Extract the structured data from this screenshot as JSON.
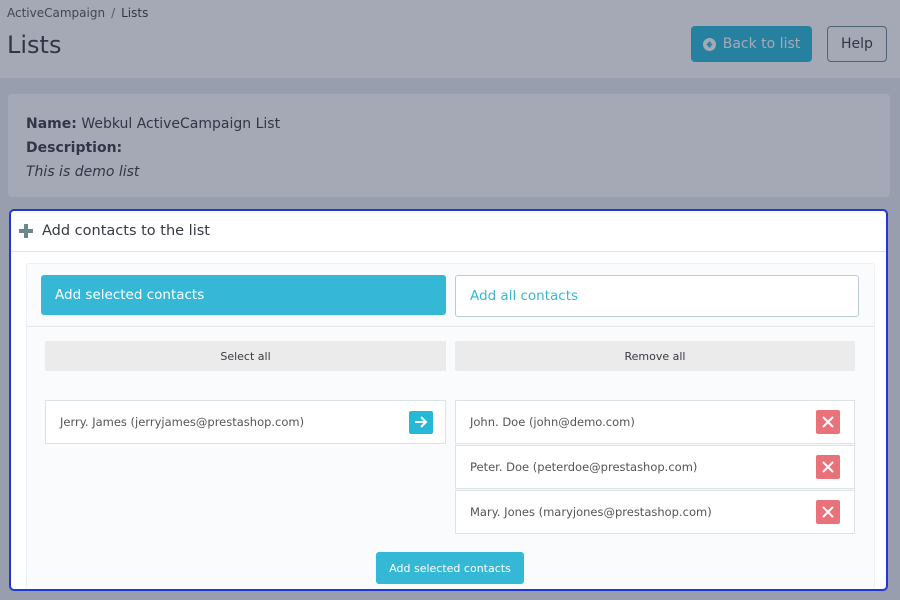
{
  "header": {
    "breadcrumb": [
      "ActiveCampaign",
      "Lists"
    ],
    "breadcrumb_separator": "/",
    "title": "Lists",
    "back_button": "Back to list",
    "help_button": "Help"
  },
  "list_info": {
    "name_label": "Name:",
    "name_value": "Webkul ActiveCampaign List",
    "description_label": "Description:",
    "description_value": "This is demo list"
  },
  "contacts_panel": {
    "heading": "Add contacts to the list",
    "tab_selected": "Add selected contacts",
    "tab_all": "Add all contacts",
    "select_all": "Select all",
    "remove_all": "Remove all",
    "available_contacts": [
      {
        "label": "Jerry. James (jerryjames@prestashop.com)"
      }
    ],
    "selected_contacts": [
      {
        "label": "John. Doe (john@demo.com)"
      },
      {
        "label": "Peter. Doe (peterdoe@prestashop.com)"
      },
      {
        "label": "Mary. Jones (maryjones@prestashop.com)"
      }
    ],
    "submit_button": "Add selected contacts"
  },
  "colors": {
    "accent": "#25b9d7",
    "danger": "#e9717a",
    "highlight_border": "#1f37d6"
  },
  "icons": {
    "back": "arrow-circle-left-icon",
    "panel": "plus-icon",
    "move": "arrow-right-icon",
    "remove": "close-icon"
  }
}
